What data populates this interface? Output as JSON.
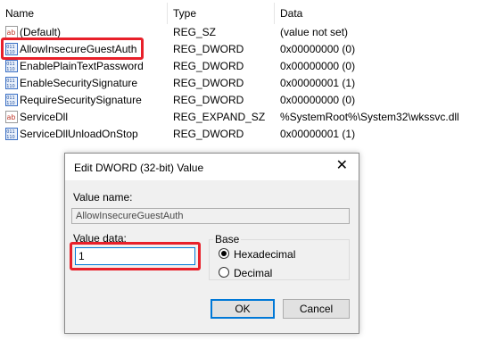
{
  "columns": {
    "name": "Name",
    "type": "Type",
    "data": "Data"
  },
  "rows": [
    {
      "icon": "string-value-icon",
      "name": "(Default)",
      "type": "REG_SZ",
      "data": "(value not set)"
    },
    {
      "icon": "dword-value-icon",
      "name": "AllowInsecureGuestAuth",
      "type": "REG_DWORD",
      "data": "0x00000000 (0)"
    },
    {
      "icon": "dword-value-icon",
      "name": "EnablePlainTextPassword",
      "type": "REG_DWORD",
      "data": "0x00000000 (0)"
    },
    {
      "icon": "dword-value-icon",
      "name": "EnableSecuritySignature",
      "type": "REG_DWORD",
      "data": "0x00000001 (1)"
    },
    {
      "icon": "dword-value-icon",
      "name": "RequireSecuritySignature",
      "type": "REG_DWORD",
      "data": "0x00000000 (0)"
    },
    {
      "icon": "string-value-icon",
      "name": "ServiceDll",
      "type": "REG_EXPAND_SZ",
      "data": "%SystemRoot%\\System32\\wkssvc.dll"
    },
    {
      "icon": "dword-value-icon",
      "name": "ServiceDllUnloadOnStop",
      "type": "REG_DWORD",
      "data": "0x00000001 (1)"
    }
  ],
  "dialog": {
    "title": "Edit DWORD (32-bit) Value",
    "value_name_label": "Value name:",
    "value_name": "AllowInsecureGuestAuth",
    "value_data_label": "Value data:",
    "value_data": "1",
    "base_label": "Base",
    "base_options": [
      "Hexadecimal",
      "Decimal"
    ],
    "base_selected": "Hexadecimal",
    "ok_label": "OK",
    "cancel_label": "Cancel"
  },
  "colors": {
    "highlight": "#e8202a",
    "focus": "#0078d7"
  }
}
